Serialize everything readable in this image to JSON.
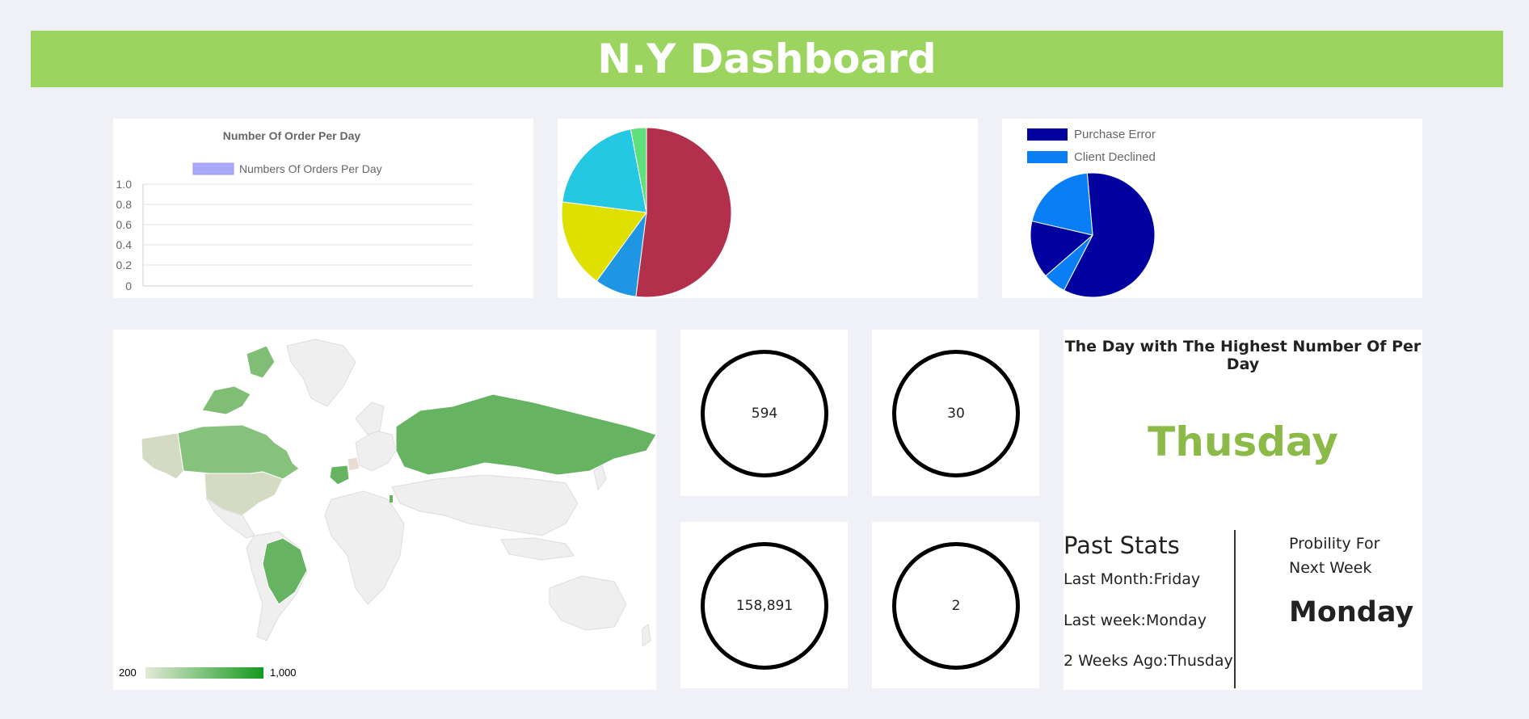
{
  "header": {
    "title": "N.Y Dashboard"
  },
  "bar_chart": {
    "title": "Number Of Order Per Day",
    "legend_label": "Numbers Of Orders Per Day",
    "legend_color": "#a9a9f9",
    "y_ticks": [
      "1.0",
      "0.8",
      "0.6",
      "0.4",
      "0.2",
      "0"
    ]
  },
  "pie_chart": {
    "colors": [
      "#b3304d",
      "#1e96e4",
      "#dfe000",
      "#24c8e3",
      "#5fe07b"
    ],
    "values": [
      52,
      8,
      17,
      20,
      3
    ]
  },
  "pie_chart_2": {
    "legend": [
      {
        "label": "Purchase Error",
        "color": "#02019f"
      },
      {
        "label": "Client Declined",
        "color": "#0a7ff5"
      }
    ],
    "colors": [
      "#02019f",
      "#0a7ff5",
      "#02019f",
      "#0a7ff5"
    ],
    "values": [
      59,
      6,
      15,
      20
    ]
  },
  "map": {
    "legend_min": "200",
    "legend_max": "1,000",
    "color_min": "#e3e9d6",
    "color_max": "#149a1e"
  },
  "stats": {
    "value_1": "594",
    "value_2": "30",
    "value_3": "158,891",
    "value_4": "2"
  },
  "day_panel": {
    "title": "The Day with The Highest Number Of Per Day",
    "highest_day": "Thusday",
    "past_stats_title": "Past Stats",
    "last_month": "Last Month:Friday",
    "last_week": "Last week:Monday",
    "two_weeks": "2 Weeks Ago:Thusday",
    "probability_label": "Probility For Next Week",
    "probability_day": "Monday"
  },
  "colors": {
    "banner": "#9bd45f",
    "background": "#f0f1f6",
    "highlight_day": "#8cba48"
  }
}
